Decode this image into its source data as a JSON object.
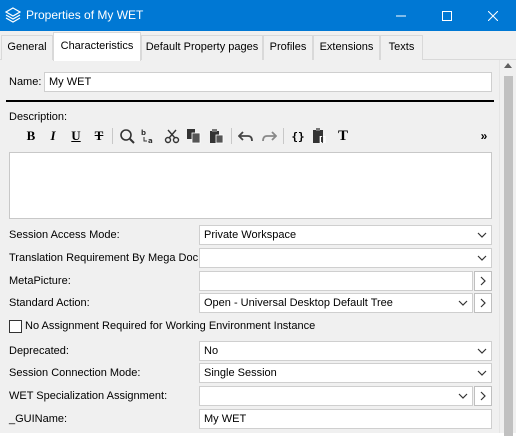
{
  "window": {
    "title": "Properties of My WET",
    "icon": "stack-layers-icon"
  },
  "tabs": [
    {
      "label": "General"
    },
    {
      "label": "Characteristics",
      "active": true
    },
    {
      "label": "Default Property pages"
    },
    {
      "label": "Profiles"
    },
    {
      "label": "Extensions"
    },
    {
      "label": "Texts"
    }
  ],
  "form": {
    "name_label": "Name:",
    "name_value": "My WET",
    "description_label": "Description:",
    "toolbar": [
      "bold",
      "italic",
      "underline",
      "strikethrough",
      "find",
      "replace",
      "cut",
      "copy",
      "paste",
      "undo",
      "redo",
      "code",
      "field",
      "text",
      "more"
    ],
    "toolbar_glyphs": {
      "bold": "B",
      "italic": "I",
      "underline": "U",
      "strikethrough": "T",
      "code": "{}",
      "text": "T",
      "more": "»"
    },
    "rows": {
      "session_access_mode": {
        "label": "Session Access Mode:",
        "value": "Private Workspace"
      },
      "translation_requirement": {
        "label": "Translation Requirement By Mega Doc:",
        "value": ""
      },
      "metapicture": {
        "label": "MetaPicture:",
        "value": ""
      },
      "standard_action": {
        "label": "Standard Action:",
        "value": "Open - Universal Desktop Default Tree"
      },
      "no_assignment": {
        "label": "No Assignment Required for Working Environment Instance",
        "checked": false
      },
      "deprecated": {
        "label": "Deprecated:",
        "value": "No"
      },
      "session_connection_mode": {
        "label": "Session Connection Mode:",
        "value": "Single Session"
      },
      "wet_specialization": {
        "label": "WET Specialization Assignment:",
        "value": ""
      },
      "guiname": {
        "label": "_GUIName:",
        "value": "My WET"
      }
    }
  },
  "colors": {
    "titlebar": "#0078d4",
    "panel": "#f0f0f0"
  }
}
